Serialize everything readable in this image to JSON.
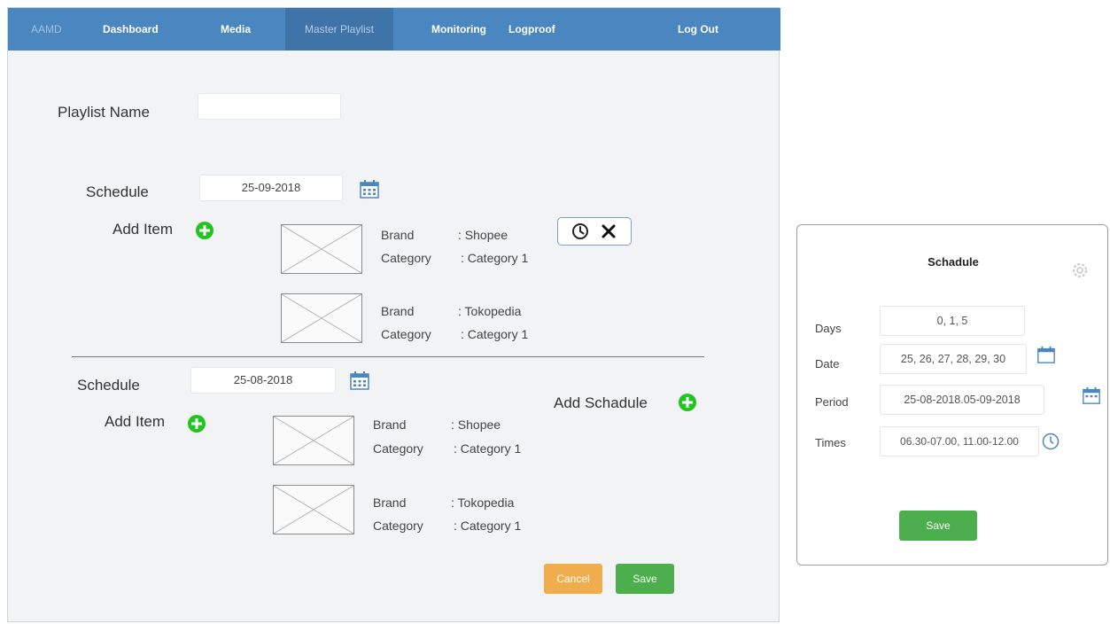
{
  "nav": {
    "brand": "AAMD",
    "items": [
      "Dashboard",
      "Media",
      "Master Playlist",
      "Monitoring",
      "Logproof"
    ],
    "logout": "Log Out",
    "active": "Master Playlist"
  },
  "form": {
    "playlist_name_label": "Playlist Name",
    "playlist_name_value": ""
  },
  "schedules": [
    {
      "label": "Schedule",
      "date": "25-09-2018",
      "add_item_label": "Add Item",
      "items": [
        {
          "brand_label": "Brand",
          "brand_value": ": Shopee",
          "category_label": "Category",
          "category_value": ": Category 1"
        },
        {
          "brand_label": "Brand",
          "brand_value": ": Tokopedia",
          "category_label": "Category",
          "category_value": ": Category 1"
        }
      ]
    },
    {
      "label": "Schedule",
      "date": "25-08-2018",
      "add_item_label": "Add Item",
      "items": [
        {
          "brand_label": "Brand",
          "brand_value": ": Shopee",
          "category_label": "Category",
          "category_value": ": Category 1"
        },
        {
          "brand_label": "Brand",
          "brand_value": ": Tokopedia",
          "category_label": "Category",
          "category_value": ": Category 1"
        }
      ]
    }
  ],
  "add_schedule_label": "Add Schadule",
  "buttons": {
    "cancel": "Cancel",
    "save": "Save"
  },
  "dialog": {
    "title": "Schadule",
    "days_label": "Days",
    "days_value": "0, 1, 5",
    "date_label": "Date",
    "date_value": "25, 26, 27, 28, 29, 30",
    "period_label": "Period",
    "period_value": "25-08-2018.05-09-2018",
    "times_label": "Times",
    "times_value": "06.30-07.00, 11.00-12.00",
    "save": "Save"
  },
  "colors": {
    "navbar": "#4a86c0",
    "add_icon": "#22c422",
    "calendar_icon": "#4a86c0",
    "cancel": "#f0ad4e",
    "save": "#4cae4c"
  }
}
